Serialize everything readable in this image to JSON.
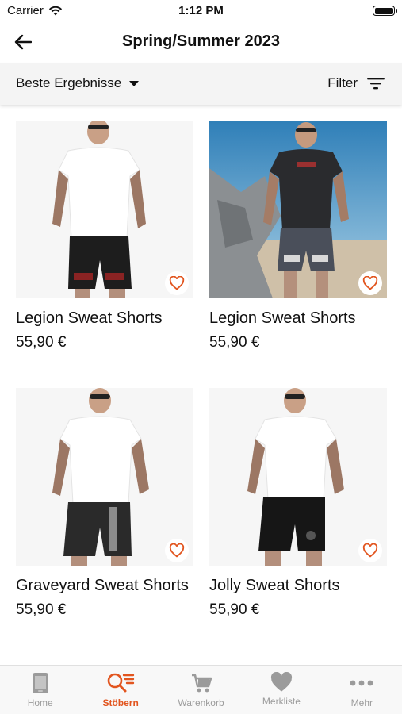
{
  "status_bar": {
    "carrier": "Carrier",
    "time": "1:12 PM"
  },
  "nav": {
    "title": "Spring/Summer 2023",
    "back_icon": "arrow-left-icon"
  },
  "toolbar": {
    "sort_label": "Beste Ergebnisse",
    "filter_label": "Filter"
  },
  "products": [
    {
      "name": "Legion Sweat Shorts",
      "price": "55,90 €"
    },
    {
      "name": "Legion Sweat Shorts",
      "price": "55,90 €"
    },
    {
      "name": "Graveyard Sweat Shorts",
      "price": "55,90 €"
    },
    {
      "name": "Jolly Sweat Shorts",
      "price": "55,90 €"
    }
  ],
  "tabs": [
    {
      "label": "Home",
      "icon": "phone-icon",
      "active": false
    },
    {
      "label": "Stöbern",
      "icon": "search-list-icon",
      "active": true
    },
    {
      "label": "Warenkorb",
      "icon": "cart-icon",
      "active": false
    },
    {
      "label": "Merkliste",
      "icon": "heart-icon",
      "active": false
    },
    {
      "label": "Mehr",
      "icon": "more-dots-icon",
      "active": false
    }
  ],
  "colors": {
    "accent": "#e2551f",
    "inactive": "#9b9b9b",
    "toolbar_bg": "#f4f4f4"
  }
}
